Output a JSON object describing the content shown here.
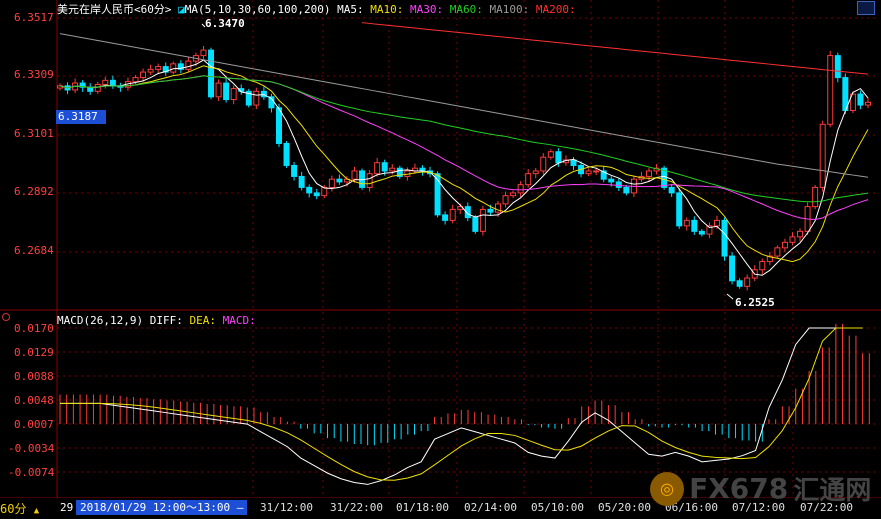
{
  "header": {
    "title": "美元在岸人民币<60分>",
    "ma_label": "MA(5,10,30,60,100,200)",
    "ma5": "MA5:",
    "ma10": "MA10:",
    "ma30": "MA30:",
    "ma60": "MA60:",
    "ma100": "MA100:",
    "ma200": "MA200:"
  },
  "macd_header": {
    "label": "MACD(26,12,9)",
    "diff": "DIFF:",
    "dea": "DEA:",
    "macd": "MACD:"
  },
  "current_price": "6.3187",
  "annotations": {
    "high": "6.3470",
    "low": "6.2525"
  },
  "price_axis": [
    "6.3517",
    "6.3309",
    "6.3101",
    "6.2892",
    "6.2684"
  ],
  "macd_axis": [
    "0.0170",
    "0.0129",
    "0.0088",
    "0.0048",
    "0.0007",
    "-0.0034",
    "-0.0074"
  ],
  "footer": {
    "period": "60分",
    "arrow": "▲",
    "day_prefix": "29",
    "time_box": "2018/01/29 12:00～13:00 —",
    "x_labels": [
      "31/12:00",
      "31/22:00",
      "01/18:00",
      "02/14:00",
      "05/10:00",
      "05/20:00",
      "06/16:00",
      "07/12:00",
      "07/22:00"
    ]
  },
  "watermark": {
    "brand": "FX678",
    "cn": "汇通网"
  },
  "colors": {
    "up": "#ff3b3b",
    "down": "#00e0ff",
    "ma5": "#ffffff",
    "ma10": "#f0e000",
    "ma30": "#ff40ff",
    "ma60": "#20d020",
    "ma100": "#9a9a9a",
    "ma200": "#ff3030",
    "axis_text": "#ff4040",
    "x_text": "#e0e0e0",
    "grid": "#7a0000"
  },
  "chart_data": {
    "type": "candlestick",
    "interval": "60分",
    "ylim": [
      6.249,
      6.3517
    ],
    "y_ticks": [
      6.3517,
      6.3309,
      6.3101,
      6.2892,
      6.2684
    ],
    "x_tick_labels": [
      "31/12:00",
      "31/22:00",
      "01/18:00",
      "02/14:00",
      "05/10:00",
      "05/20:00",
      "06/16:00",
      "07/12:00",
      "07/22:00"
    ],
    "high_label": 6.347,
    "low_label": 6.2525,
    "last_close": 6.3187,
    "close_series": [
      6.327,
      6.3255,
      6.328,
      6.3265,
      6.325,
      6.3275,
      6.329,
      6.327,
      6.3265,
      6.3285,
      6.33,
      6.332,
      6.333,
      6.334,
      6.332,
      6.335,
      6.333,
      6.336,
      6.338,
      6.34,
      6.323,
      6.328,
      6.322,
      6.326,
      6.325,
      6.32,
      6.325,
      6.323,
      6.319,
      6.306,
      6.298,
      6.294,
      6.29,
      6.288,
      6.287,
      6.29,
      6.293,
      6.292,
      6.293,
      6.296,
      6.29,
      6.295,
      6.299,
      6.296,
      6.297,
      6.294,
      6.296,
      6.297,
      6.296,
      6.295,
      6.28,
      6.278,
      6.282,
      6.283,
      6.279,
      6.274,
      6.282,
      6.281,
      6.284,
      6.287,
      6.288,
      6.291,
      6.295,
      6.296,
      6.301,
      6.303,
      6.299,
      6.3,
      6.298,
      6.295,
      6.296,
      6.296,
      6.293,
      6.292,
      6.29,
      6.288,
      6.293,
      6.294,
      6.296,
      6.297,
      6.29,
      6.288,
      6.276,
      6.278,
      6.274,
      6.273,
      6.276,
      6.278,
      6.265,
      6.256,
      6.254,
      6.257,
      6.26,
      6.263,
      6.265,
      6.268,
      6.27,
      6.272,
      6.274,
      6.283,
      6.29,
      6.313,
      6.338,
      6.33,
      6.318,
      6.324,
      6.32,
      6.321
    ],
    "macd_hist_sample": [
      0.005,
      0.005,
      0.005,
      0.005,
      0.0048,
      0.0046,
      0.0044,
      0.0042,
      0.004,
      0.0038,
      0.0036,
      0.0034,
      0.0032,
      0.003,
      0.0028,
      0.002,
      0.0012,
      0.0004,
      -0.0008,
      -0.0016,
      -0.0024,
      -0.003,
      -0.0034,
      -0.0036,
      -0.0032,
      -0.0026,
      -0.0018,
      -0.0012,
      0.0012,
      0.0018,
      0.0024,
      0.002,
      0.0016,
      0.0012,
      0.0008,
      -0.0002,
      -0.0006,
      -0.0008,
      0.001,
      0.003,
      0.004,
      0.0032,
      0.002,
      0.0008,
      -0.0004,
      -0.0006,
      -0.0002,
      -0.0006,
      -0.0012,
      -0.0018,
      -0.0024,
      -0.0028,
      -0.003,
      0.0008,
      0.003,
      0.006,
      0.009,
      0.013,
      0.017,
      0.015,
      0.012
    ]
  }
}
